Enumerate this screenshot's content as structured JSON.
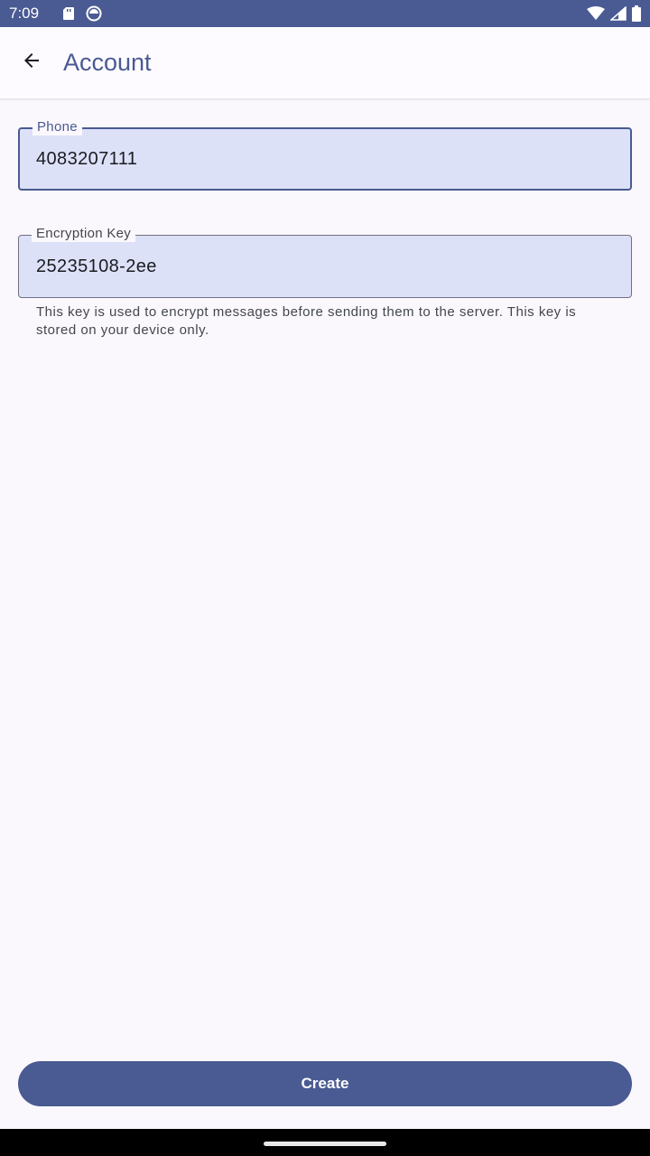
{
  "status_bar": {
    "time": "7:09",
    "icons_left": [
      "sd-card-icon",
      "sync-icon"
    ],
    "icons_right": [
      "wifi-icon",
      "signal-icon",
      "battery-icon"
    ],
    "background_color": "#4a5a92"
  },
  "app_bar": {
    "back_icon": "arrow-back-icon",
    "title": "Account"
  },
  "form": {
    "phone": {
      "label": "Phone",
      "value": "4083207111",
      "focused": true
    },
    "encryption_key": {
      "label": "Encryption Key",
      "value": "25235108-2ee",
      "helper": "This key is used to encrypt messages before sending them to the server. This key is stored on your device only."
    }
  },
  "actions": {
    "create_label": "Create"
  },
  "colors": {
    "primary": "#4a5a92",
    "field_fill": "#dde1f8",
    "background": "#fbf8fd"
  }
}
